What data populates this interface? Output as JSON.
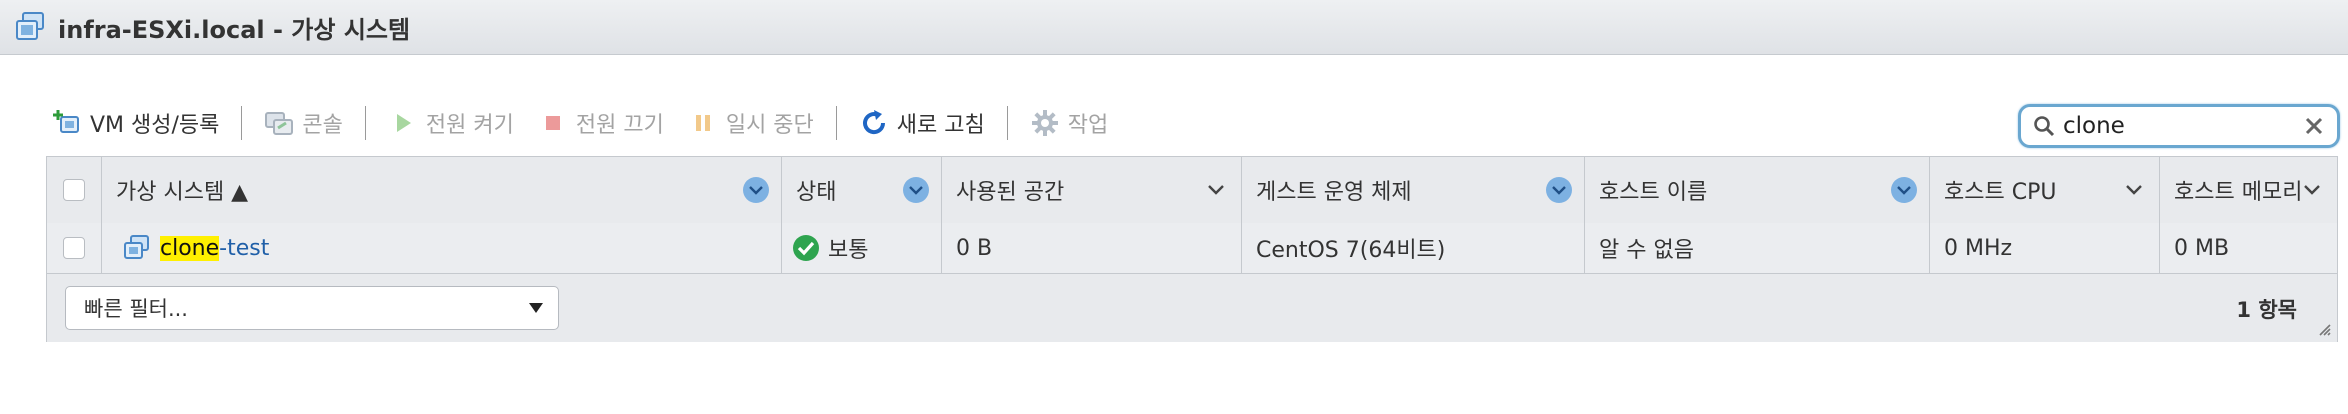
{
  "window": {
    "title": "infra-ESXi.local - 가상 시스템"
  },
  "toolbar": {
    "create_label": "VM 생성/등록",
    "console_label": "콘솔",
    "power_on_label": "전원 켜기",
    "power_off_label": "전원 끄기",
    "suspend_label": "일시 중단",
    "refresh_label": "새로 고침",
    "actions_label": "작업"
  },
  "search": {
    "value": "clone"
  },
  "table": {
    "columns": [
      "가상 시스템 ▲",
      "상태",
      "사용된 공간",
      "게스트 운영 체제",
      "호스트 이름",
      "호스트 CPU",
      "호스트 메모리"
    ],
    "rows": [
      {
        "name_highlight": "clone",
        "name_rest": "-test",
        "status": "보통",
        "used_space": "0 B",
        "guest_os": "CentOS 7(64비트)",
        "host_name": "알 수 없음",
        "host_cpu": "0 MHz",
        "host_memory": "0 MB"
      }
    ]
  },
  "footer": {
    "quick_filter": "빠른 필터...",
    "count": "1 항목"
  },
  "colors": {
    "accent": "#1f5fa8",
    "search_border": "#6aa7d0",
    "status_ok": "#2ea44f",
    "highlight": "#fff000"
  }
}
